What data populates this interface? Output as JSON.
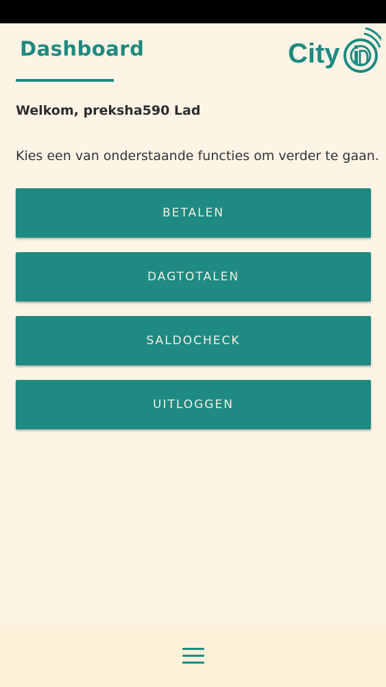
{
  "header": {
    "title": "Dashboard",
    "logo_text": "City iD"
  },
  "welcome": {
    "text": "Welkom, preksha590 Lad"
  },
  "instruction": {
    "text": "Kies een van onderstaande functies om verder te gaan."
  },
  "menu": {
    "items": [
      {
        "label": "BETALEN"
      },
      {
        "label": "DAGTOTALEN"
      },
      {
        "label": "SALDOCHECK"
      },
      {
        "label": "UITLOGGEN"
      }
    ]
  },
  "bottom_nav": {
    "icon": "hamburger-menu-icon"
  },
  "colors": {
    "accent": "#1E8A81",
    "background": "#FDF4E6",
    "bottom_bar": "#FDF0D9",
    "button_text": "#F4EFE4"
  }
}
